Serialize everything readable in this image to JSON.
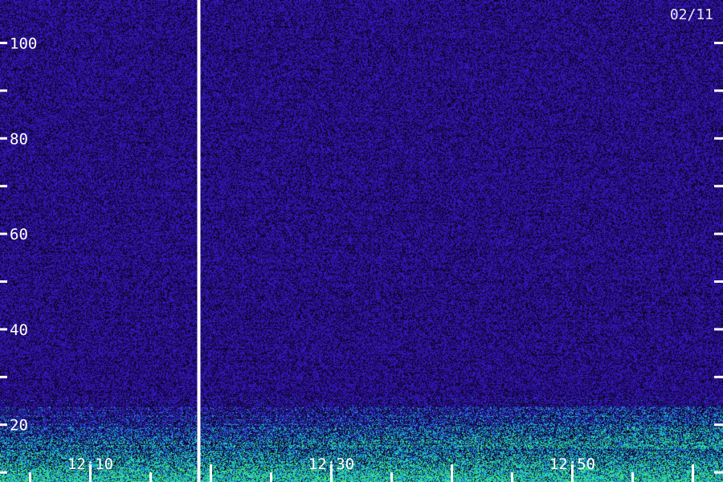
{
  "chart_data": {
    "type": "heatmap",
    "date_label": "02/11",
    "y_ticks": [
      {
        "value": 100,
        "label": "100"
      },
      {
        "value": 90,
        "label": ""
      },
      {
        "value": 80,
        "label": "80"
      },
      {
        "value": 70,
        "label": ""
      },
      {
        "value": 60,
        "label": "60"
      },
      {
        "value": 50,
        "label": ""
      },
      {
        "value": 40,
        "label": "40"
      },
      {
        "value": 30,
        "label": ""
      },
      {
        "value": 20,
        "label": "20"
      },
      {
        "value": 10,
        "label": ""
      }
    ],
    "x_ticks": [
      {
        "value": "12:05",
        "label": "",
        "major": false
      },
      {
        "value": "12:10",
        "label": "12:10",
        "major": true
      },
      {
        "value": "12:15",
        "label": "",
        "major": false
      },
      {
        "value": "12:20",
        "label": "",
        "major": true
      },
      {
        "value": "12:25",
        "label": "",
        "major": false
      },
      {
        "value": "12:30",
        "label": "12:30",
        "major": true
      },
      {
        "value": "12:35",
        "label": "",
        "major": false
      },
      {
        "value": "12:40",
        "label": "",
        "major": true
      },
      {
        "value": "12:45",
        "label": "",
        "major": false
      },
      {
        "value": "12:50",
        "label": "12:50",
        "major": true
      },
      {
        "value": "12:55",
        "label": "",
        "major": false
      },
      {
        "value": "13:00",
        "label": "",
        "major": true
      }
    ],
    "ylim": [
      8,
      109
    ],
    "xlim": [
      "12:02:30",
      "13:02:30"
    ],
    "time_break": "12:19",
    "colors": {
      "background": "#0a0320",
      "noise": "#3a1aa8",
      "low": "#1f5fd8",
      "mid": "#19c3d6",
      "high": "#3ef07a",
      "axis": "#ffffff"
    }
  }
}
